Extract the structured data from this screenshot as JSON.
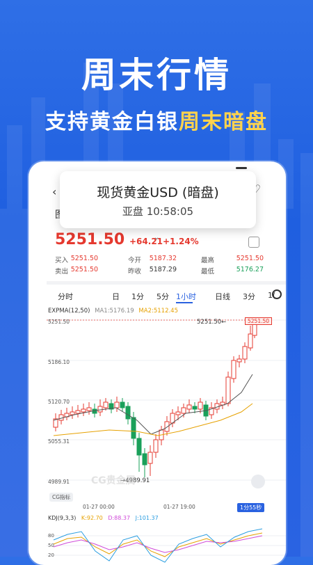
{
  "hero": {
    "title": "周末行情",
    "subtitle_pre": "支持黄金白银",
    "subtitle_hl": "周末暗盘"
  },
  "phone": {
    "nav": {
      "back": "‹",
      "tab_left": "图"
    },
    "popup": {
      "title": "现货黄金USD (暗盘)",
      "time": "亚盘 10:58:05"
    },
    "quote": {
      "price": "5251.50",
      "change": "+64.21",
      "change_pct": "+1.24%",
      "rows": [
        [
          {
            "label": "买入",
            "value": "5251.50",
            "color": "red"
          },
          {
            "label": "今开",
            "value": "5187.32",
            "color": "red"
          },
          {
            "label": "最高",
            "value": "5251.50",
            "color": "red"
          }
        ],
        [
          {
            "label": "卖出",
            "value": "5251.50",
            "color": "red"
          },
          {
            "label": "昨收",
            "value": "5187.29",
            "color": "dark"
          },
          {
            "label": "最低",
            "value": "5176.27",
            "color": "green"
          }
        ]
      ]
    },
    "periods": [
      "分时",
      "日",
      "1分",
      "5分",
      "1小时",
      "日线",
      "3分",
      "1("
    ],
    "active_period": "1小时",
    "indicators": {
      "main": "EXPMA(12,50)",
      "ma1": "MA1:5176.19",
      "ma2": "MA2:5112.45",
      "colors": {
        "ma1": "#888888",
        "ma2": "#e6a100"
      }
    },
    "chart": {
      "y_labels": [
        "5251.50",
        "5186.10",
        "5120.70",
        "5055.31",
        "4989.91"
      ],
      "last_price_tag": "5251.50",
      "high_label": "5251.50←",
      "low_label": "→4989.91",
      "cg_button": "CG指标",
      "watermark": "CG贵金属",
      "date_start": "01-27 00:00",
      "date_end": "01-27 19:00",
      "countdown": "1分55秒"
    },
    "kdj": {
      "title": "KDJ(9,3,3)",
      "k": "K:92.70",
      "d": "D:88.37",
      "j": "J:101.37",
      "y_labels": [
        "80",
        "50",
        "20"
      ],
      "colors": {
        "k": "#e6a100",
        "d": "#d04bd9",
        "j": "#2a9de0"
      }
    },
    "colors": {
      "up": "#e5392f",
      "down": "#1aa05a",
      "accent": "#2a62e0"
    }
  }
}
